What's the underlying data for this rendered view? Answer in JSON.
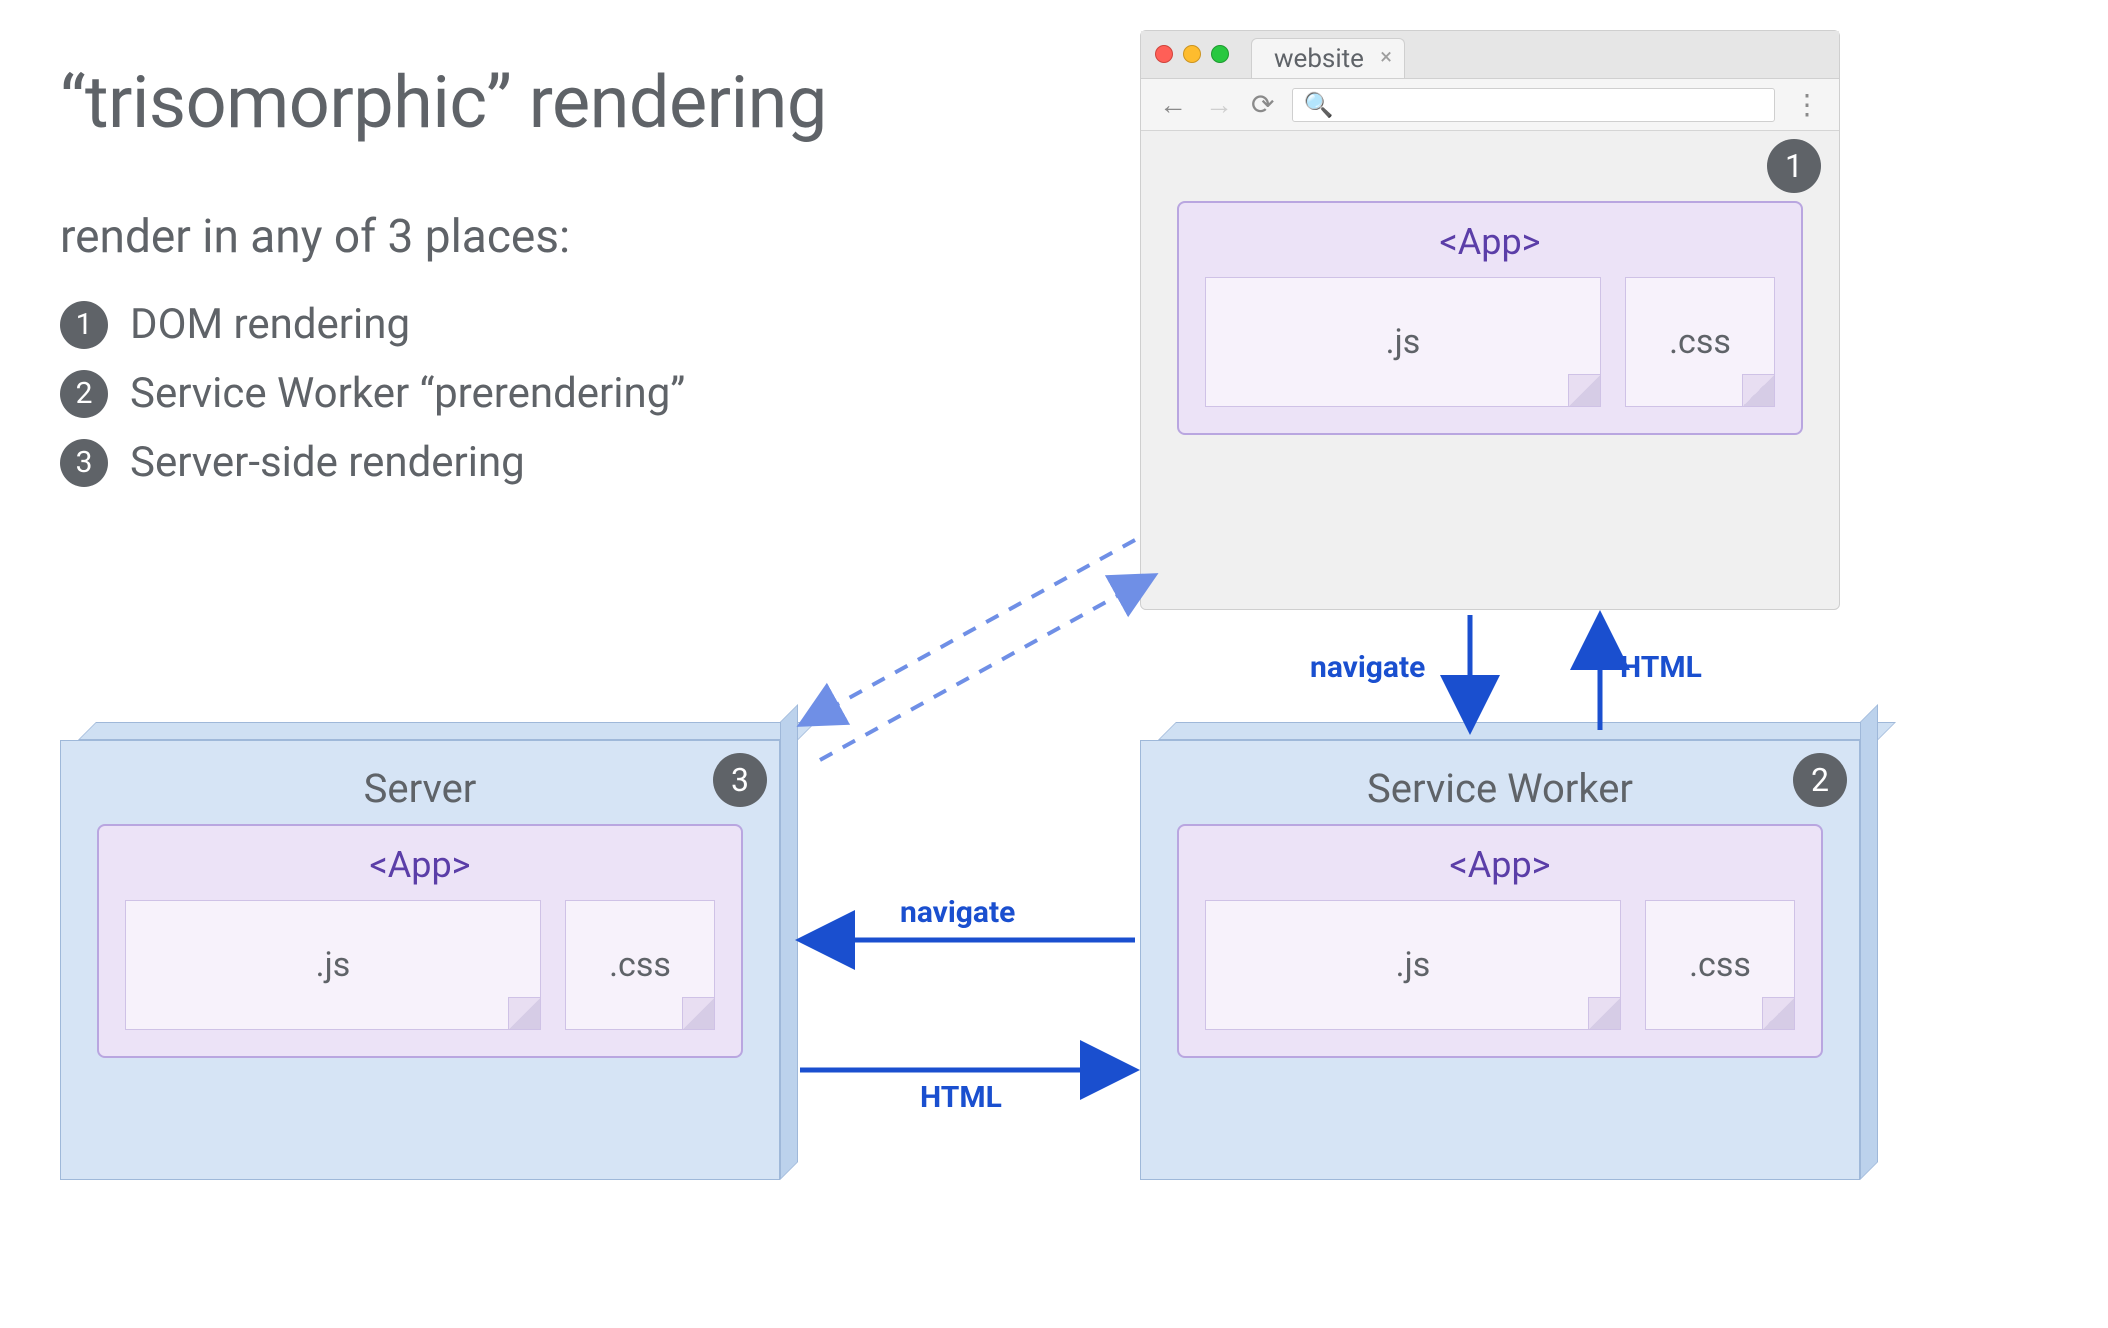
{
  "title": "“trisomorphic” rendering",
  "subtitle": "render in any of 3 places:",
  "list": [
    {
      "num": "1",
      "label": "DOM rendering"
    },
    {
      "num": "2",
      "label": "Service Worker “prerendering”"
    },
    {
      "num": "3",
      "label": "Server-side rendering"
    }
  ],
  "browser": {
    "tab_label": "website",
    "search_glyph": "🔍",
    "badge": "1",
    "app": {
      "title": "<App>",
      "js": ".js",
      "css": ".css"
    }
  },
  "server_panel": {
    "title": "Server",
    "badge": "3",
    "app": {
      "title": "<App>",
      "js": ".js",
      "css": ".css"
    }
  },
  "sw_panel": {
    "title": "Service Worker",
    "badge": "2",
    "app": {
      "title": "<App>",
      "js": ".js",
      "css": ".css"
    }
  },
  "edges": {
    "browser_sw_down": "navigate",
    "browser_sw_up": "HTML",
    "sw_server_left": "navigate",
    "sw_server_right": "HTML"
  },
  "colors": {
    "text": "#5f6368",
    "arrow": "#1a4fcf",
    "panel": "#d6e4f5",
    "app_bg": "#ece3f7",
    "app_border": "#b9a6e0",
    "app_title": "#5b3ea8"
  }
}
